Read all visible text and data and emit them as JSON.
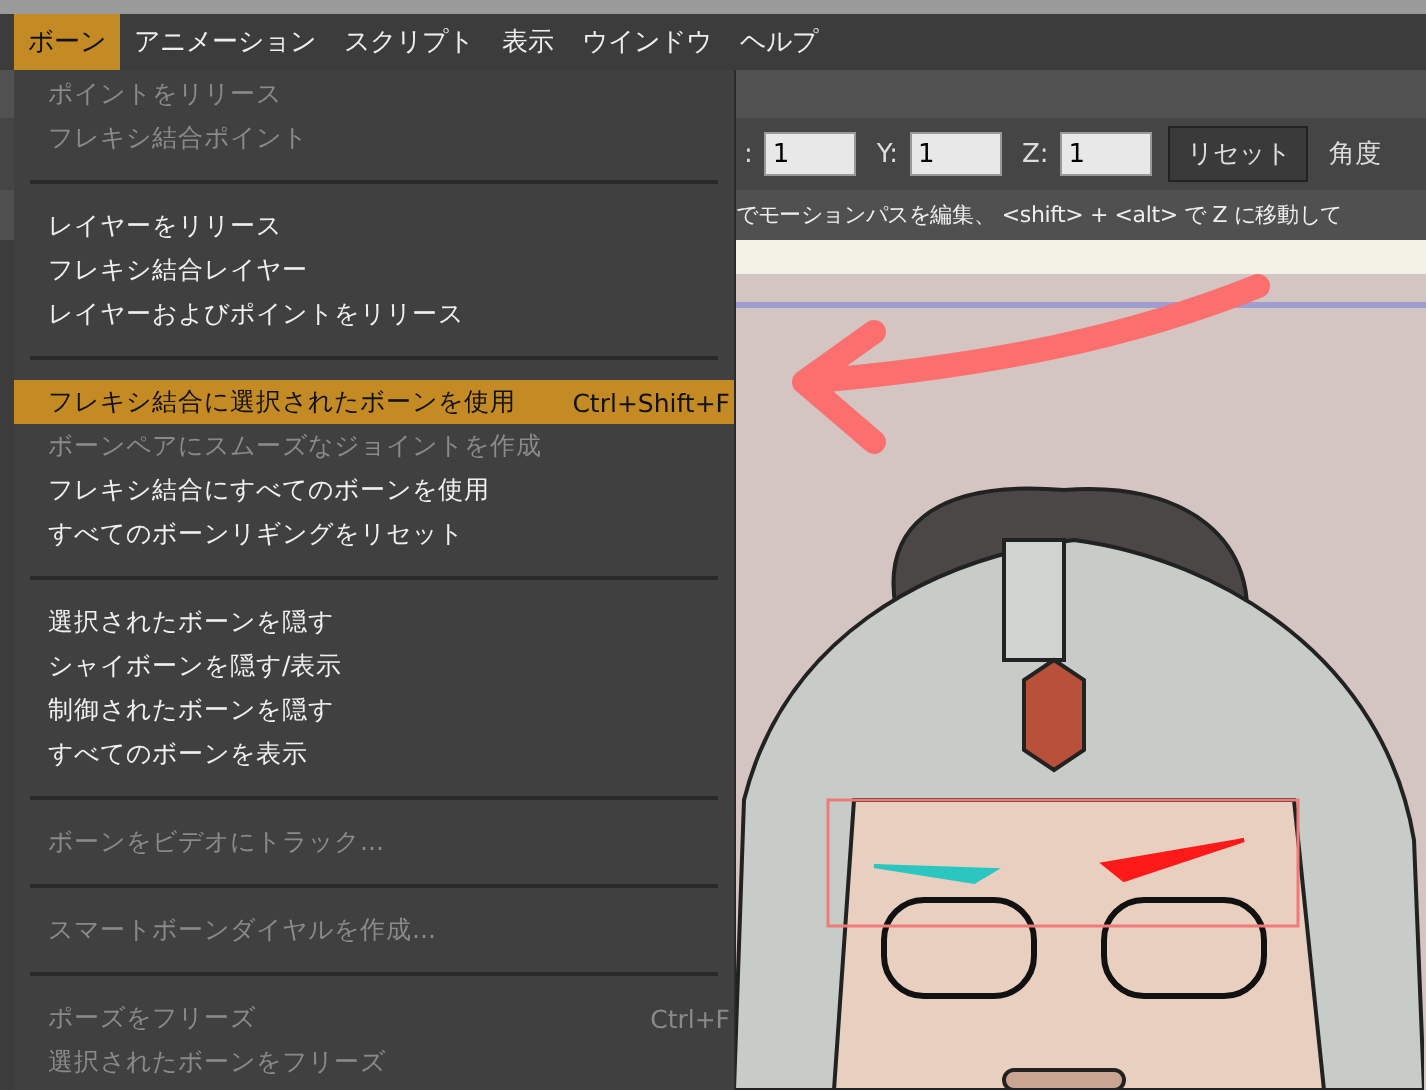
{
  "menubar": [
    {
      "label": "ボーン",
      "selected": true
    },
    {
      "label": "アニメーション",
      "selected": false
    },
    {
      "label": "スクリプト",
      "selected": false
    },
    {
      "label": "表示",
      "selected": false
    },
    {
      "label": "ウインドウ",
      "selected": false
    },
    {
      "label": "ヘルプ",
      "selected": false
    }
  ],
  "menu": [
    {
      "kind": "item",
      "label": "ポイントをリリース",
      "disabled": true,
      "selected": false
    },
    {
      "kind": "item",
      "label": "フレキシ結合ポイント",
      "disabled": true,
      "selected": false
    },
    {
      "kind": "separator"
    },
    {
      "kind": "item",
      "label": "レイヤーをリリース",
      "disabled": false,
      "selected": false
    },
    {
      "kind": "item",
      "label": "フレキシ結合レイヤー",
      "disabled": false,
      "selected": false
    },
    {
      "kind": "item",
      "label": "レイヤーおよびポイントをリリース",
      "disabled": false,
      "selected": false
    },
    {
      "kind": "separator"
    },
    {
      "kind": "item",
      "label": "フレキシ結合に選択されたボーンを使用",
      "shortcut": "Ctrl+Shift+F",
      "disabled": false,
      "selected": true
    },
    {
      "kind": "item",
      "label": "ボーンペアにスムーズなジョイントを作成",
      "disabled": true,
      "selected": false
    },
    {
      "kind": "item",
      "label": "フレキシ結合にすべてのボーンを使用",
      "disabled": false,
      "selected": false
    },
    {
      "kind": "item",
      "label": "すべてのボーンリギングをリセット",
      "disabled": false,
      "selected": false
    },
    {
      "kind": "separator"
    },
    {
      "kind": "item",
      "label": "選択されたボーンを隠す",
      "disabled": false,
      "selected": false
    },
    {
      "kind": "item",
      "label": "シャイボーンを隠す/表示",
      "disabled": false,
      "selected": false
    },
    {
      "kind": "item",
      "label": "制御されたボーンを隠す",
      "disabled": false,
      "selected": false
    },
    {
      "kind": "item",
      "label": "すべてのボーンを表示",
      "disabled": false,
      "selected": false
    },
    {
      "kind": "separator"
    },
    {
      "kind": "item",
      "label": "ボーンをビデオにトラック...",
      "disabled": true,
      "selected": false
    },
    {
      "kind": "separator"
    },
    {
      "kind": "item",
      "label": "スマートボーンダイヤルを作成...",
      "disabled": true,
      "selected": false
    },
    {
      "kind": "separator"
    },
    {
      "kind": "item",
      "label": "ポーズをフリーズ",
      "shortcut": "Ctrl+F",
      "disabled": true,
      "selected": false
    },
    {
      "kind": "item",
      "label": "選択されたボーンをフリーズ",
      "disabled": true,
      "selected": false
    }
  ],
  "toolbar": {
    "fields": [
      {
        "label": ":",
        "value": "1"
      },
      {
        "label": "Y:",
        "value": "1"
      },
      {
        "label": "Z:",
        "value": "1"
      }
    ],
    "reset_button": "リセット",
    "angle_label": "角度"
  },
  "hint": "でモーションパスを編集、 <shift> + <alt> で Z に移動して"
}
